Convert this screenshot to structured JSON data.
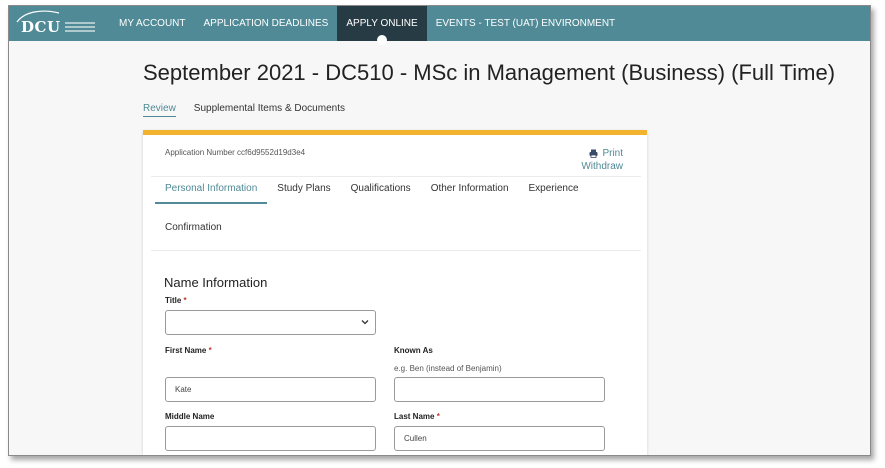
{
  "nav": {
    "logo_text": "DCU",
    "items": [
      {
        "label": "MY ACCOUNT"
      },
      {
        "label": "APPLICATION DEADLINES"
      },
      {
        "label": "APPLY ONLINE"
      },
      {
        "label": "EVENTS - TEST (UAT) ENVIRONMENT"
      }
    ]
  },
  "page": {
    "title": "September 2021 - DC510 - MSc in Management (Business) (Full Time)",
    "subtabs": [
      {
        "label": "Review"
      },
      {
        "label": "Supplemental Items & Documents"
      }
    ]
  },
  "card": {
    "application_number": "Application Number ccf6d9552d19d3e4",
    "print_label": "Print",
    "withdraw_label": "Withdraw",
    "tabs": [
      {
        "label": "Personal Information"
      },
      {
        "label": "Study Plans"
      },
      {
        "label": "Qualifications"
      },
      {
        "label": "Other Information"
      },
      {
        "label": "Experience"
      },
      {
        "label": "Confirmation"
      }
    ],
    "section_title": "Name Information",
    "fields": {
      "title": {
        "label": "Title",
        "required": "*",
        "value": ""
      },
      "first_name": {
        "label": "First Name",
        "required": "*",
        "value": "Kate"
      },
      "known_as": {
        "label": "Known As",
        "hint": "e.g. Ben (instead of Benjamin)",
        "value": ""
      },
      "middle_name": {
        "label": "Middle Name",
        "value": ""
      },
      "last_name": {
        "label": "Last Name",
        "required": "*",
        "value": "Cullen"
      }
    }
  },
  "colors": {
    "nav_bg": "#4f8a96",
    "nav_active": "#273b44",
    "accent": "#f2b32e",
    "link": "#4f8a96",
    "required": "#c0392b"
  }
}
